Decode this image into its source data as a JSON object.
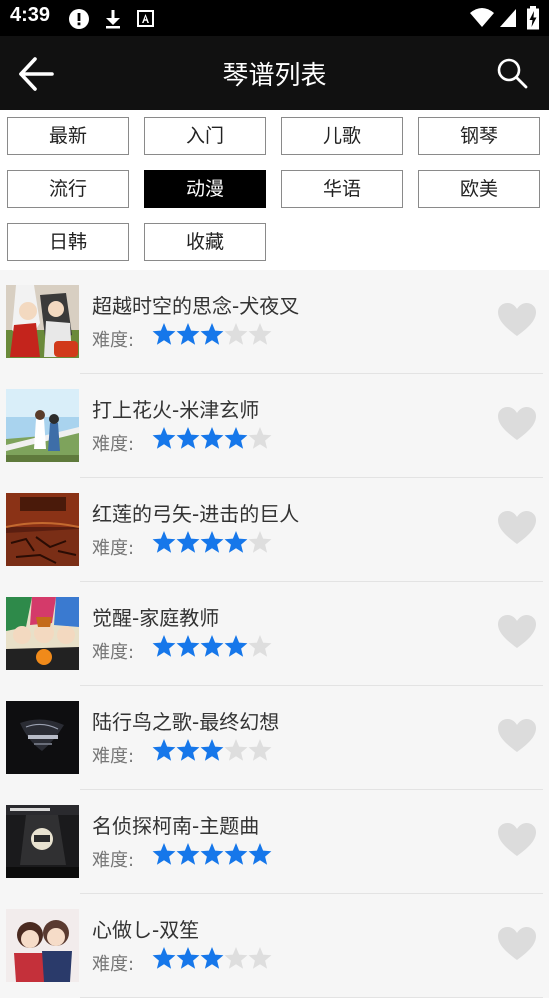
{
  "status_bar": {
    "time": "4:39"
  },
  "app_bar": {
    "title": "琴谱列表"
  },
  "categories": [
    {
      "label": "最新",
      "active": false
    },
    {
      "label": "入门",
      "active": false
    },
    {
      "label": "儿歌",
      "active": false
    },
    {
      "label": "钢琴",
      "active": false
    },
    {
      "label": "流行",
      "active": false
    },
    {
      "label": "动漫",
      "active": true
    },
    {
      "label": "华语",
      "active": false
    },
    {
      "label": "欧美",
      "active": false
    },
    {
      "label": "日韩",
      "active": false
    },
    {
      "label": "收藏",
      "active": false
    }
  ],
  "difficulty_label": "难度:",
  "star_colors": {
    "filled": "#1677ea",
    "empty": "#dedede"
  },
  "songs": [
    {
      "title": "超越时空的思念-犬夜叉",
      "difficulty": 3
    },
    {
      "title": "打上花火-米津玄师",
      "difficulty": 4
    },
    {
      "title": "红莲的弓矢-进击的巨人",
      "difficulty": 4
    },
    {
      "title": "觉醒-家庭教师",
      "difficulty": 4
    },
    {
      "title": "陆行鸟之歌-最终幻想",
      "difficulty": 3
    },
    {
      "title": "名侦探柯南-主题曲",
      "difficulty": 5
    },
    {
      "title": "心做し-双笙",
      "difficulty": 3
    }
  ]
}
